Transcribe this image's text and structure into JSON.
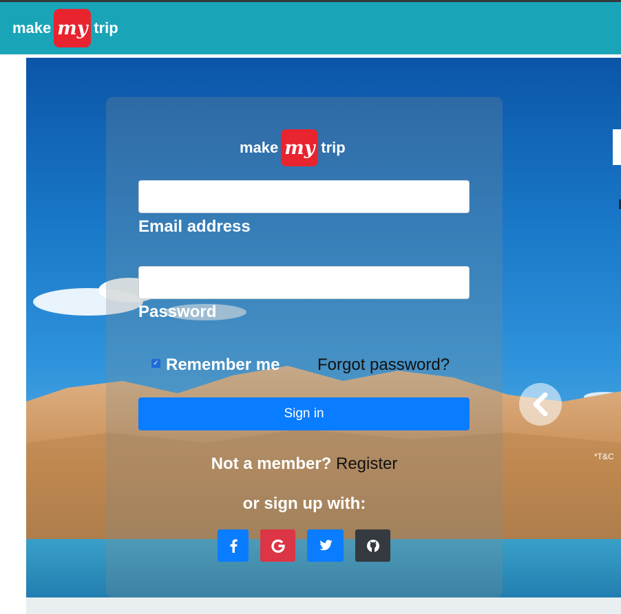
{
  "header": {
    "logo": {
      "make": "make",
      "my": "my",
      "trip": "trip"
    }
  },
  "login": {
    "logo": {
      "make": "make",
      "my": "my",
      "trip": "trip"
    },
    "email_label": "Email address",
    "email_value": "",
    "password_label": "Password",
    "password_value": "",
    "remember_label": "Remember me",
    "remember_checked": true,
    "forgot_label": "Forgot password?",
    "signin_label": "Sign in",
    "member_text": "Not a member?",
    "register_label": "Register",
    "signup_with": "or sign up with:",
    "social": [
      "facebook-icon",
      "google-icon",
      "twitter-icon",
      "github-icon"
    ]
  },
  "banner": {
    "tnc": "*T&C"
  },
  "colors": {
    "header": "#1aa4b8",
    "brand_red": "#e8242f",
    "primary": "#0a7cff",
    "google": "#dc3545",
    "github": "#343a40"
  }
}
